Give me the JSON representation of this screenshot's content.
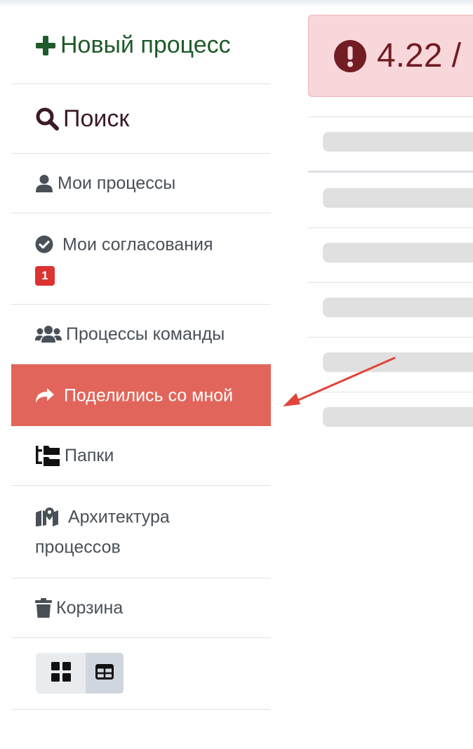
{
  "sidebar": {
    "new_process": "Новый процесс",
    "search": "Поиск",
    "items": [
      {
        "label": "Мои процессы",
        "icon": "user-icon"
      },
      {
        "label": "Мои согласования",
        "icon": "check-circle-icon",
        "badge": "1"
      },
      {
        "label": "Процессы команды",
        "icon": "users-icon"
      },
      {
        "label": "Поделились со мной",
        "icon": "share-icon",
        "active": true
      },
      {
        "label": "Папки",
        "icon": "folder-tree-icon"
      },
      {
        "label": "Архитектура процессов",
        "icon": "map-marked-icon"
      },
      {
        "label": "Корзина",
        "icon": "trash-icon"
      }
    ],
    "view_toggle": {
      "options": [
        "grid-view-icon",
        "table-view-icon"
      ],
      "selected": "table-view-icon"
    }
  },
  "main": {
    "alert_text": "4.22 /",
    "alert_icon": "exclamation-circle-icon"
  },
  "colors": {
    "primary_green": "#1e5a2a",
    "active_bg": "#e2655b",
    "alert_bg": "#f8d7da",
    "alert_text": "#721c24",
    "badge": "#dc3232",
    "annotation_arrow": "#e0443a"
  }
}
